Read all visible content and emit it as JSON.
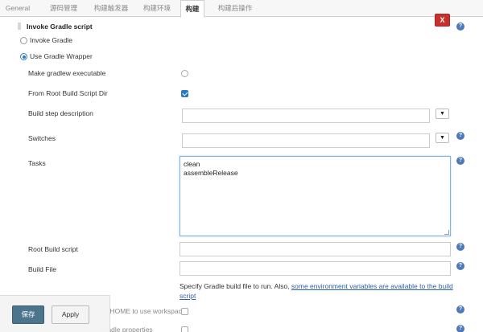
{
  "tabs": [
    "General",
    "源码管理",
    "构建触发器",
    "构建环境",
    "构建",
    "构建后操作"
  ],
  "active_tab": "构建",
  "section": {
    "title": "Invoke Gradle script",
    "delete_label": "X"
  },
  "radio": {
    "invoke_gradle": "Invoke Gradle",
    "use_wrapper": "Use Gradle Wrapper"
  },
  "fields": {
    "make_executable": "Make gradlew executable",
    "from_root": "From Root Build Script Dir",
    "build_step_description": "Build step description",
    "switches": "Switches",
    "tasks": "Tasks",
    "tasks_value": "clean\nassembleRelease",
    "root_build_script": "Root Build script",
    "build_file": "Build File",
    "workspace_partial": "ER_HOME to use workspace",
    "gradle_props_partial": "Gradle properties"
  },
  "note": {
    "prefix": "Specify Gradle build file to run. Also, ",
    "link": "some environment variables are available to the build script"
  },
  "buttons": {
    "save": "保存",
    "apply": "Apply"
  },
  "help_glyph": "?",
  "dropdown_glyph": "▼",
  "colors": {
    "accent": "#2b7bc4",
    "delete": "#c9302c",
    "save": "#4b758b"
  }
}
